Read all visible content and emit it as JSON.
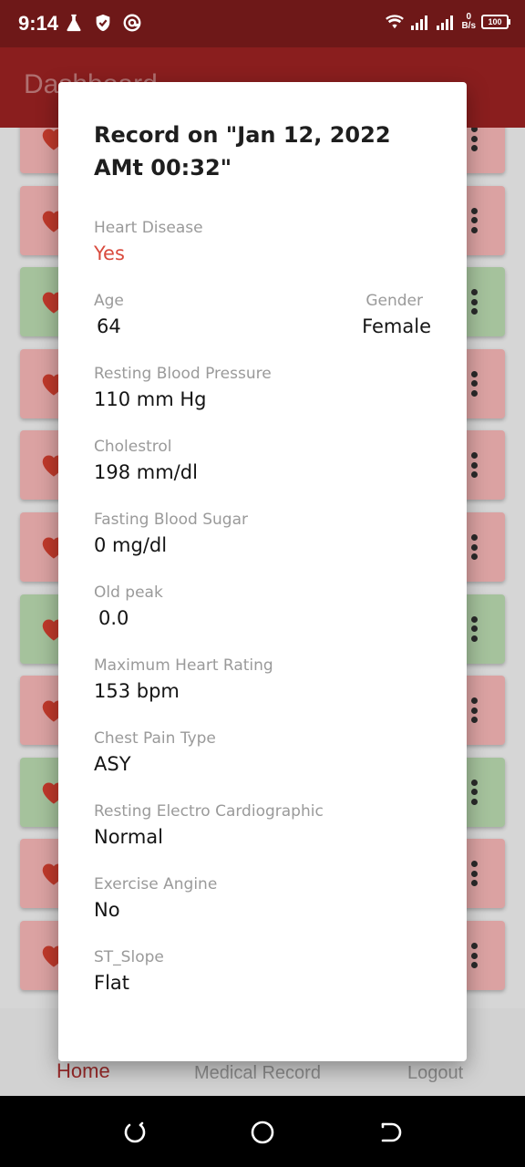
{
  "status_bar": {
    "time": "9:14",
    "net_speed_value": "0",
    "net_speed_unit": "B/s",
    "battery": "100"
  },
  "app_bar": {
    "title": "Dashboard"
  },
  "record_list": [
    {
      "status": "red"
    },
    {
      "status": "red"
    },
    {
      "status": "green"
    },
    {
      "status": "red"
    },
    {
      "status": "red"
    },
    {
      "status": "red"
    },
    {
      "status": "green"
    },
    {
      "status": "red"
    },
    {
      "status": "green"
    },
    {
      "status": "red"
    },
    {
      "status": "red"
    }
  ],
  "bottom_nav": {
    "home": "Home",
    "medical_record": "Medical Record",
    "logout": "Logout"
  },
  "dialog": {
    "title": "Record on \"Jan 12, 2022 AMt 00:32\"",
    "heart_disease": {
      "label": "Heart Disease",
      "value": "Yes"
    },
    "age": {
      "label": "Age",
      "value": "64"
    },
    "gender": {
      "label": "Gender",
      "value": "Female"
    },
    "resting_bp": {
      "label": "Resting Blood Pressure",
      "value": "110 mm Hg"
    },
    "cholesterol": {
      "label": "Cholestrol",
      "value": "198 mm/dl"
    },
    "fasting_sugar": {
      "label": "Fasting Blood Sugar",
      "value": "0 mg/dl"
    },
    "old_peak": {
      "label": "Old peak",
      "value": "0.0"
    },
    "max_heart_rate": {
      "label": "Maximum Heart Rating",
      "value": "153 bpm"
    },
    "chest_pain": {
      "label": "Chest Pain Type",
      "value": "ASY"
    },
    "resting_ecg": {
      "label": "Resting Electro Cardiographic",
      "value": "Normal"
    },
    "exercise_angina": {
      "label": "Exercise Angine",
      "value": "No"
    },
    "st_slope": {
      "label": "ST_Slope",
      "value": "Flat"
    }
  },
  "colors": {
    "primary": "#8a1e1e",
    "status_bar": "#6e1818",
    "alert_value": "#d94a3d",
    "card_red": "#dba2a2",
    "card_green": "#a5c29c",
    "heart": "#c0392b"
  },
  "icons": {
    "status_left": [
      "flask-icon",
      "shield-check-icon",
      "at-sign-icon"
    ],
    "status_right": [
      "wifi-icon",
      "signal-icon",
      "signal-icon",
      "battery-icon"
    ],
    "card": [
      "heart-icon",
      "more-vert-icon"
    ],
    "system_nav": [
      "recent-apps-icon",
      "home-circle-icon",
      "back-icon"
    ]
  }
}
